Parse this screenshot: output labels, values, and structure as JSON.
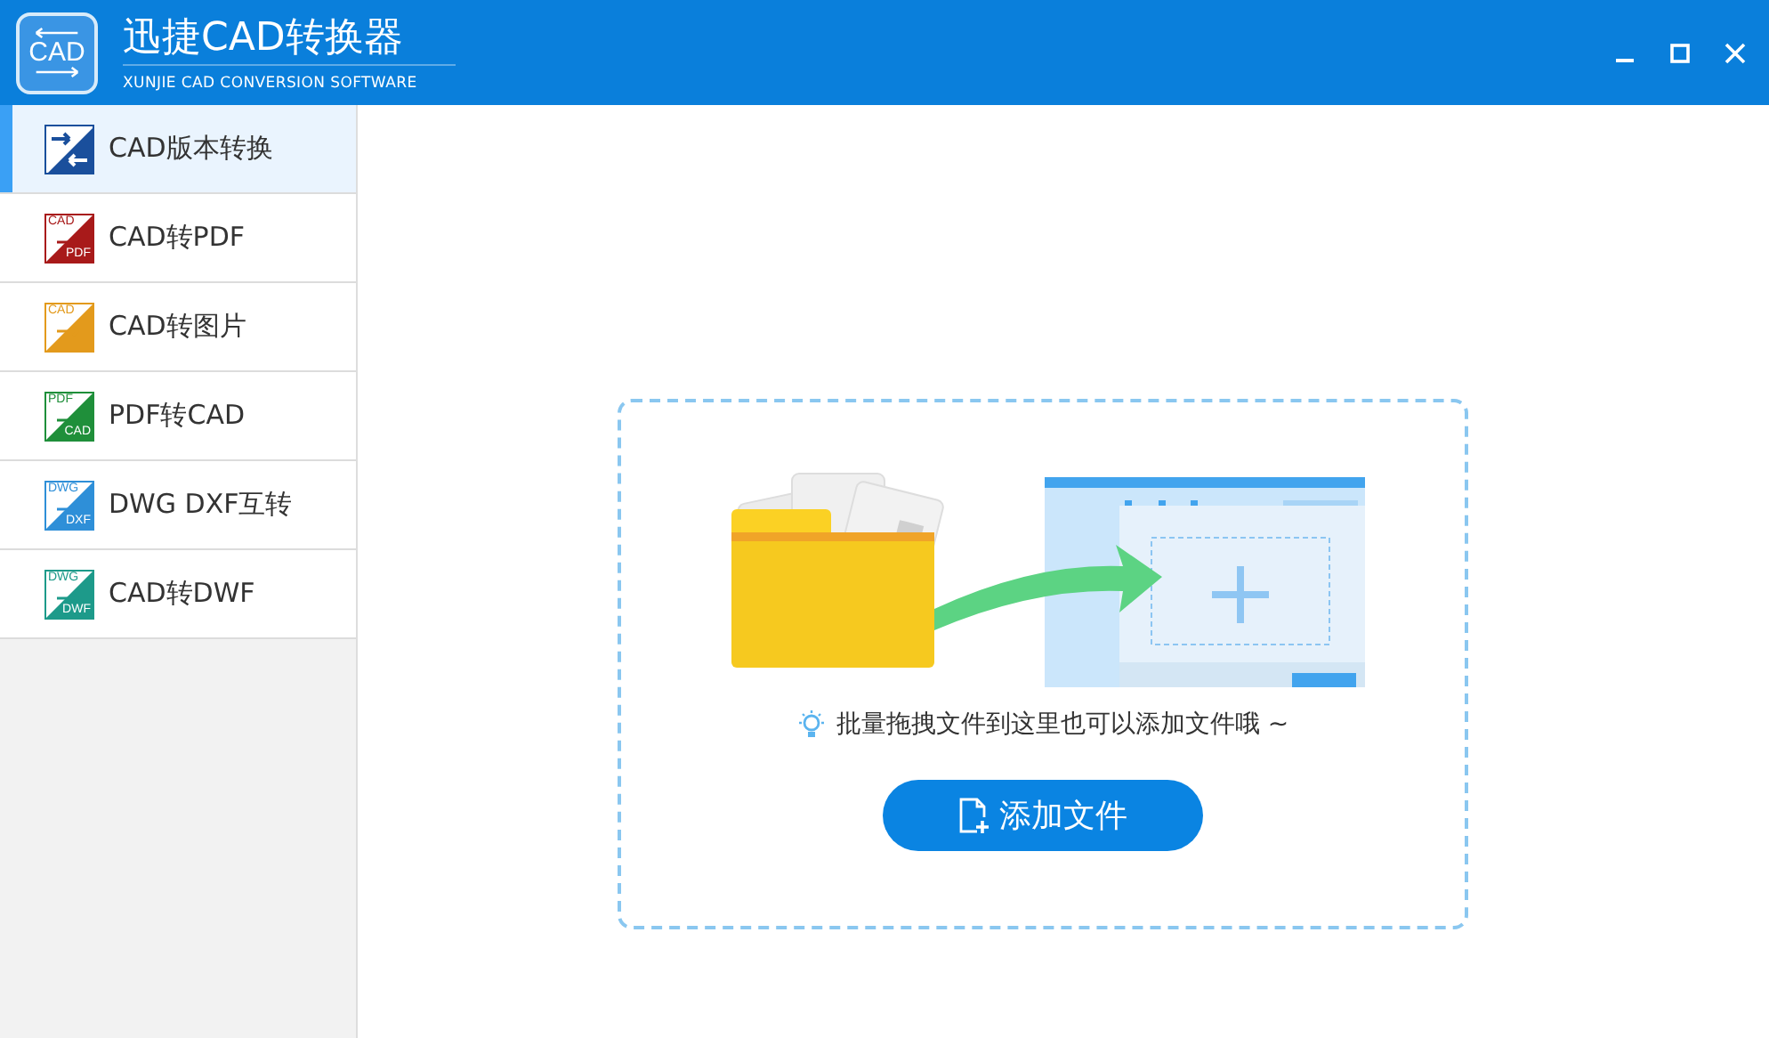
{
  "window": {
    "logo_text": "CAD",
    "title": "迅捷CAD转换器",
    "subtitle": "XUNJIE CAD CONVERSION SOFTWARE"
  },
  "sidebar": {
    "items": [
      {
        "label": "CAD版本转换",
        "selected": true,
        "kind": "version",
        "color": "#1a4f9c"
      },
      {
        "label": "CAD转PDF",
        "selected": false,
        "kind": "labeled",
        "color": "#a81a1a",
        "icon_top": "CAD",
        "icon_bottom": "PDF"
      },
      {
        "label": "CAD转图片",
        "selected": false,
        "kind": "labeled",
        "color": "#e39a1c",
        "icon_top": "CAD"
      },
      {
        "label": "PDF转CAD",
        "selected": false,
        "kind": "labeled",
        "color": "#1f8f3a",
        "icon_top": "PDF",
        "icon_bottom": "CAD"
      },
      {
        "label": "DWG DXF互转",
        "selected": false,
        "kind": "labeled",
        "color": "#2e8fd8",
        "icon_top": "DWG",
        "icon_bottom": "DXF"
      },
      {
        "label": "CAD转DWF",
        "selected": false,
        "kind": "labeled",
        "color": "#1d9a8a",
        "icon_top": "DWG",
        "icon_bottom": "DWF"
      }
    ]
  },
  "dropzone": {
    "hint": "批量拖拽文件到这里也可以添加文件哦 ~",
    "button": "添加文件"
  }
}
